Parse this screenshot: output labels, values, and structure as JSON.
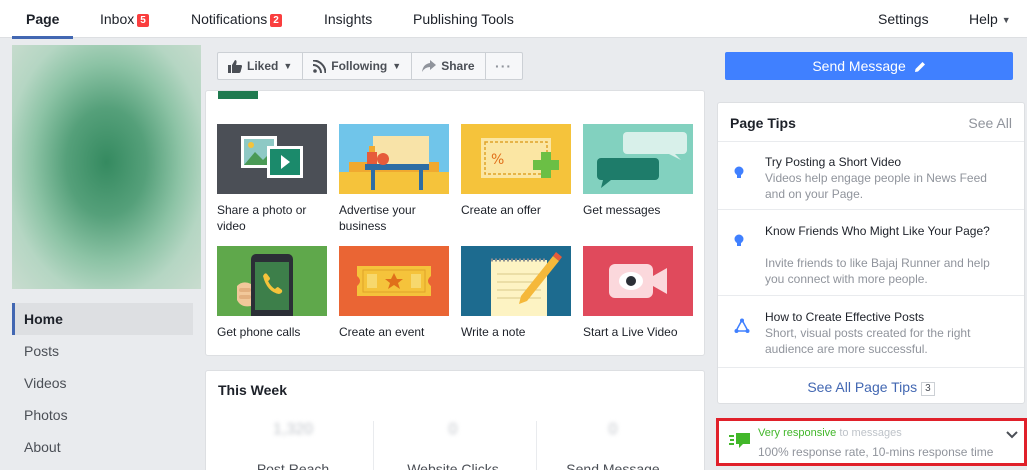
{
  "topnav": {
    "tabs": [
      {
        "label": "Page",
        "badge": ""
      },
      {
        "label": "Inbox",
        "badge": "5"
      },
      {
        "label": "Notifications",
        "badge": "2"
      },
      {
        "label": "Insights",
        "badge": ""
      },
      {
        "label": "Publishing Tools",
        "badge": ""
      }
    ],
    "settings": "Settings",
    "help": "Help"
  },
  "leftnav": [
    "Home",
    "Posts",
    "Videos",
    "Photos",
    "About"
  ],
  "actions": {
    "liked": "Liked",
    "following": "Following",
    "share": "Share",
    "send_message": "Send Message"
  },
  "tiles": [
    "Share a photo or video",
    "Advertise your business",
    "Create an offer",
    "Get messages",
    "Get phone calls",
    "Create an event",
    "Write a note",
    "Start a Live Video"
  ],
  "this_week": {
    "title": "This Week",
    "stats": [
      {
        "value": "1,320",
        "label": "Post Reach"
      },
      {
        "value": "0",
        "label": "Website Clicks"
      },
      {
        "value": "0",
        "label": "Send Message"
      }
    ]
  },
  "page_tips": {
    "title": "Page Tips",
    "see_all": "See All",
    "tips": [
      {
        "title": "Try Posting a Short Video",
        "desc": "Videos help engage people in News Feed and on your Page."
      },
      {
        "title": "Know Friends Who Might Like Your Page?",
        "desc": "Invite friends to like Bajaj Runner and help you connect with more people."
      },
      {
        "title": "How to Create Effective Posts",
        "desc": "Short, visual posts created for the right audience are more successful."
      }
    ],
    "footer": "See All Page Tips",
    "footer_count": "3"
  },
  "responsiveness": {
    "status": "Very responsive",
    "suffix": "to messages",
    "detail": "100% response rate, 10-mins response time"
  },
  "colors": {
    "brand_blue": "#4267b2",
    "send_button": "#4080ff",
    "badge_red": "#fa3e3e",
    "responsive_green": "#42b72a",
    "highlight_red": "#e0202a"
  }
}
